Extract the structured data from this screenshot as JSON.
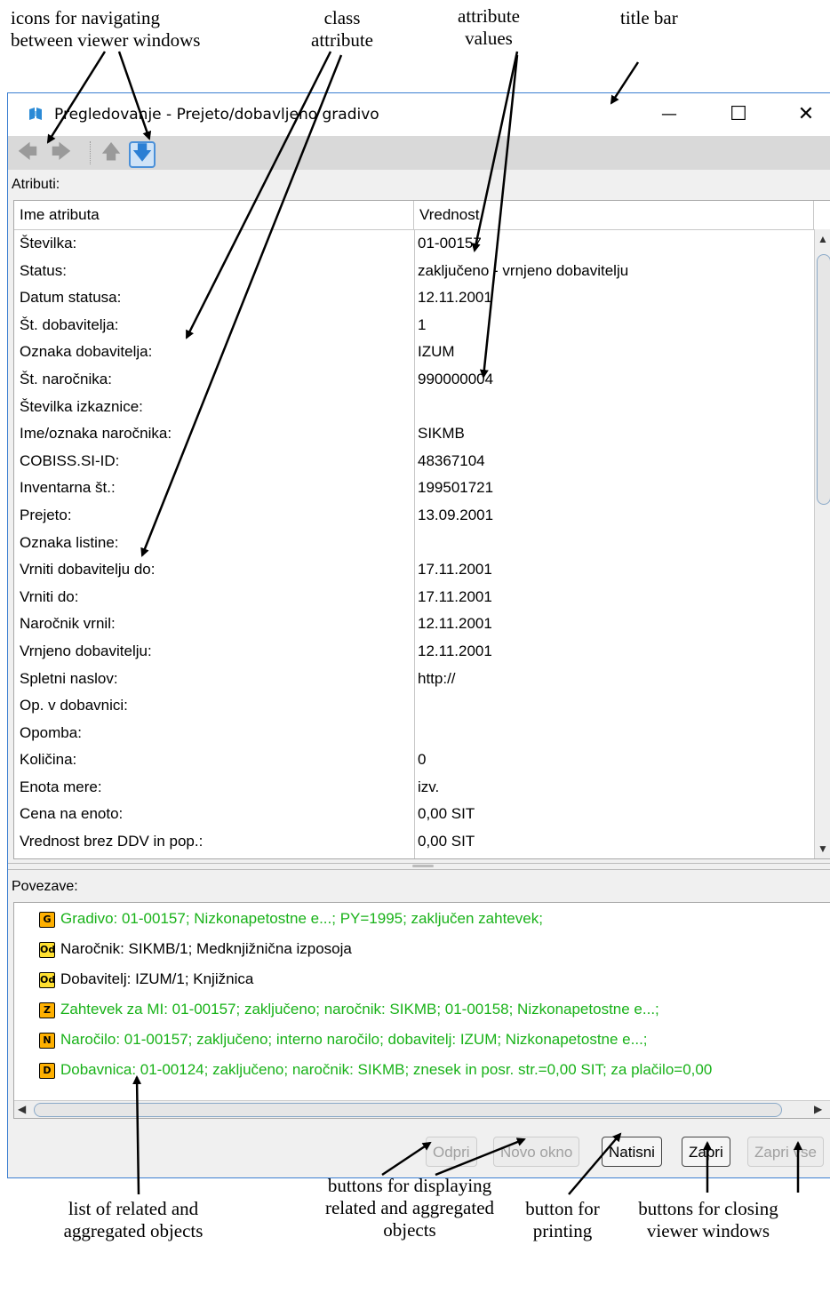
{
  "annotations": {
    "nav_icons": [
      "icons for navigating",
      "between viewer windows"
    ],
    "class_attr": [
      "class",
      "attribute"
    ],
    "attr_values": [
      "attribute",
      "values"
    ],
    "title_bar": "title bar",
    "related_list": [
      "list of related and",
      "aggregated objects"
    ],
    "display_buttons": [
      "buttons for displaying",
      "related and aggregated",
      "objects"
    ],
    "print_button": [
      "button for",
      "printing"
    ],
    "close_buttons": [
      "buttons for closing",
      "viewer windows"
    ]
  },
  "window": {
    "title": "Pregledovanje - Prejeto/dobavljeno gradivo",
    "minimize": "—",
    "maximize": "☐",
    "close": "✕"
  },
  "toolbar": {
    "back": "🡄",
    "forward": "🡆",
    "up": "🡅",
    "down": "🡇"
  },
  "attributes_label": "Atributi:",
  "table": {
    "col_name": "Ime atributa",
    "col_value": "Vrednost",
    "rows": [
      [
        "Številka:",
        "01-00157"
      ],
      [
        "Status:",
        "zaključeno - vrnjeno dobavitelju"
      ],
      [
        "Datum statusa:",
        "12.11.2001"
      ],
      [
        "Št. dobavitelja:",
        "1"
      ],
      [
        "Oznaka dobavitelja:",
        "IZUM"
      ],
      [
        "Št. naročnika:",
        "990000004"
      ],
      [
        "Številka izkaznice:",
        ""
      ],
      [
        "Ime/oznaka naročnika:",
        "SIKMB"
      ],
      [
        "COBISS.SI-ID:",
        "48367104"
      ],
      [
        "Inventarna št.:",
        "199501721"
      ],
      [
        "Prejeto:",
        "13.09.2001"
      ],
      [
        "Oznaka listine:",
        ""
      ],
      [
        "Vrniti dobavitelju do:",
        "17.11.2001"
      ],
      [
        "Vrniti do:",
        "17.11.2001"
      ],
      [
        "Naročnik vrnil:",
        "12.11.2001"
      ],
      [
        "Vrnjeno dobavitelju:",
        "12.11.2001"
      ],
      [
        "Spletni naslov:",
        "http://"
      ],
      [
        "Op. v dobavnici:",
        ""
      ],
      [
        "Opomba:",
        ""
      ],
      [
        "Količina:",
        "0"
      ],
      [
        "Enota mere:",
        "izv."
      ],
      [
        "Cena na enoto:",
        "0,00 SIT"
      ],
      [
        "Vrednost brez DDV in pop.:",
        "0,00 SIT"
      ]
    ]
  },
  "relations_label": "Povezave:",
  "relations": [
    {
      "icon": "G",
      "color": "#ffb000",
      "text": "Gradivo: 01-00157; Nizkonapetostne e...; PY=1995; zaključen zahtevek;",
      "green": true
    },
    {
      "icon": "Od",
      "color": "#ffe030",
      "text": "Naročnik: SIKMB/1; Medknjižnična izposoja",
      "green": false
    },
    {
      "icon": "Od",
      "color": "#ffe030",
      "text": "Dobavitelj: IZUM/1; Knjižnica",
      "green": false
    },
    {
      "icon": "Z",
      "color": "#ffb000",
      "text": "Zahtevek za MI: 01-00157; zaključeno; naročnik: SIKMB; 01-00158; Nizkonapetostne e...;",
      "green": true
    },
    {
      "icon": "N",
      "color": "#ffb000",
      "text": "Naročilo: 01-00157; zaključeno; interno naročilo; dobavitelj: IZUM; Nizkonapetostne e...;",
      "green": true
    },
    {
      "icon": "D",
      "color": "#ffb000",
      "text": "Dobavnica: 01-00124; zaključeno; naročnik: SIKMB; znesek in posr. str.=0,00 SIT; za plačilo=0,00",
      "green": true
    }
  ],
  "buttons": {
    "open": "Odpri",
    "new_window": "Novo okno",
    "print": "Natisni",
    "close": "Zapri",
    "close_all": "Zapri vse"
  }
}
